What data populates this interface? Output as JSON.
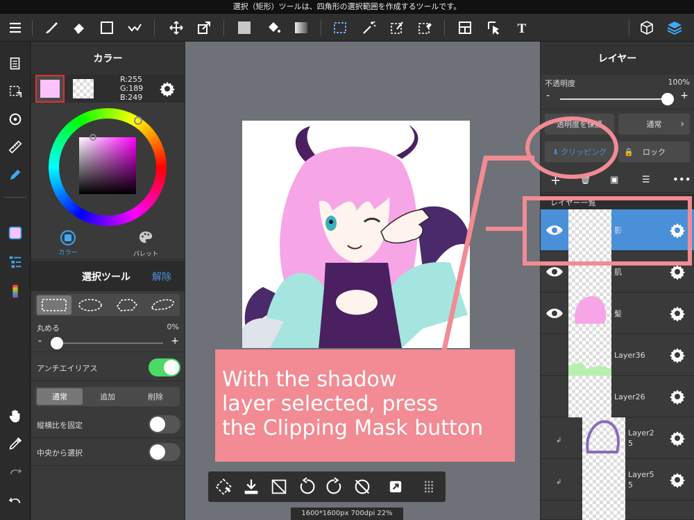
{
  "status_bar": {
    "text": "選択（矩形）ツールは、四角形の選択範囲を作成するツールです。"
  },
  "color_panel": {
    "title": "カラー",
    "rgb": {
      "r": "R:255",
      "g": "G:189",
      "b": "B:249"
    },
    "primary_color": "#fbc2fb",
    "tabs": [
      {
        "label": "カラー"
      },
      {
        "label": "パレット"
      }
    ]
  },
  "select_tool": {
    "title": "選択ツール",
    "release": "解除",
    "roundness_label": "丸める",
    "roundness_value": "0%",
    "antialias_label": "アンチエイリアス",
    "antialias_on": true,
    "modes": [
      "通常",
      "追加",
      "削除"
    ],
    "fix_aspect_label": "縦横比を固定",
    "from_center_label": "中央から選択"
  },
  "layer_panel": {
    "title": "レイヤー",
    "opacity_label": "不透明度",
    "opacity_value": "100%",
    "protect_alpha": "透明度を保護",
    "blend_mode": "通常",
    "clipping": "クリッピング",
    "lock": "ロック",
    "list_header": "レイヤー一覧",
    "layers": [
      {
        "name": "影",
        "selected": true
      },
      {
        "name": "肌"
      },
      {
        "name": "髪"
      },
      {
        "name": "Layer36"
      },
      {
        "name": "Layer26"
      },
      {
        "name": "Layer2\n5"
      },
      {
        "name": "Layer5\n5"
      }
    ]
  },
  "canvas": {
    "info": "1600*1600px 700dpi 22%"
  },
  "annotation": {
    "text": "With the shadow\nlayer selected, press\nthe Clipping Mask button",
    "color": "#f28b93"
  },
  "colors": {
    "accent": "#4a90d9",
    "toggle_on": "#4cd964",
    "callout": "#f28b93"
  }
}
